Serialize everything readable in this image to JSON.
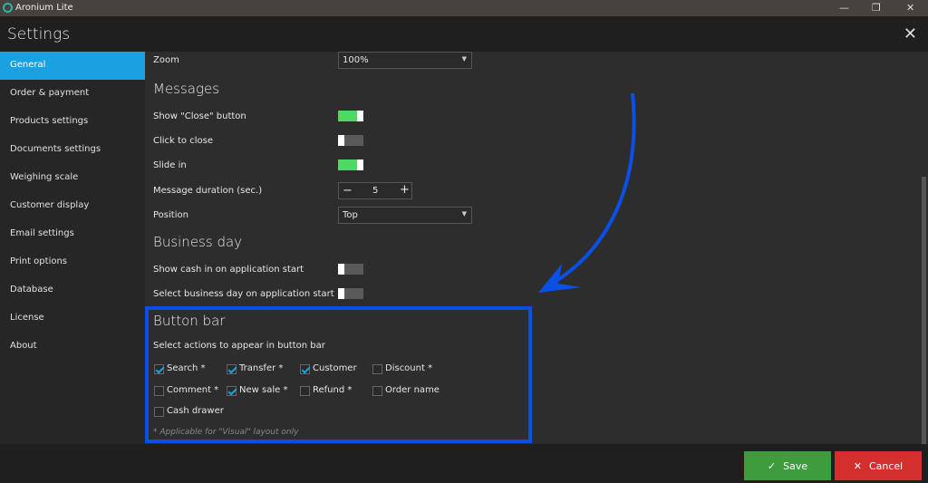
{
  "app": {
    "title": "Aronium Lite",
    "window_title": "Settings"
  },
  "sidebar": {
    "items": [
      {
        "label": "General",
        "active": true
      },
      {
        "label": "Order & payment"
      },
      {
        "label": "Products settings"
      },
      {
        "label": "Documents settings"
      },
      {
        "label": "Weighing scale"
      },
      {
        "label": "Customer display"
      },
      {
        "label": "Email settings"
      },
      {
        "label": "Print options"
      },
      {
        "label": "Database"
      },
      {
        "label": "License"
      },
      {
        "label": "About"
      }
    ]
  },
  "general": {
    "zoom_label": "Zoom",
    "zoom_value": "100%"
  },
  "messages": {
    "title": "Messages",
    "show_close_label": "Show \"Close\" button",
    "show_close_on": true,
    "click_to_close_label": "Click to close",
    "click_to_close_on": false,
    "slide_in_label": "Slide in",
    "slide_in_on": true,
    "duration_label": "Message duration (sec.)",
    "duration_value": "5",
    "position_label": "Position",
    "position_value": "Top"
  },
  "business_day": {
    "title": "Business day",
    "show_cash_label": "Show cash in on application start",
    "select_day_label": "Select business day on application start"
  },
  "button_bar": {
    "title": "Button bar",
    "subtitle": "Select actions to appear in button bar",
    "actions": [
      {
        "label": "Search *",
        "checked": true
      },
      {
        "label": "Transfer *",
        "checked": true
      },
      {
        "label": "Customer",
        "checked": true
      },
      {
        "label": "Discount *",
        "checked": false
      },
      {
        "label": "Comment *",
        "checked": false
      },
      {
        "label": "New sale *",
        "checked": true
      },
      {
        "label": "Refund *",
        "checked": false
      },
      {
        "label": "Order name",
        "checked": false
      },
      {
        "label": "Cash drawer",
        "checked": false
      }
    ],
    "note": "* Applicable for \"Visual\" layout only"
  },
  "footer": {
    "save_label": "Save",
    "cancel_label": "Cancel"
  },
  "colors": {
    "accent": "#1ba1e2",
    "toggle_on": "#4cd964",
    "save": "#3e9b3e",
    "cancel": "#d32f2f",
    "annotation": "#0a50e6"
  }
}
